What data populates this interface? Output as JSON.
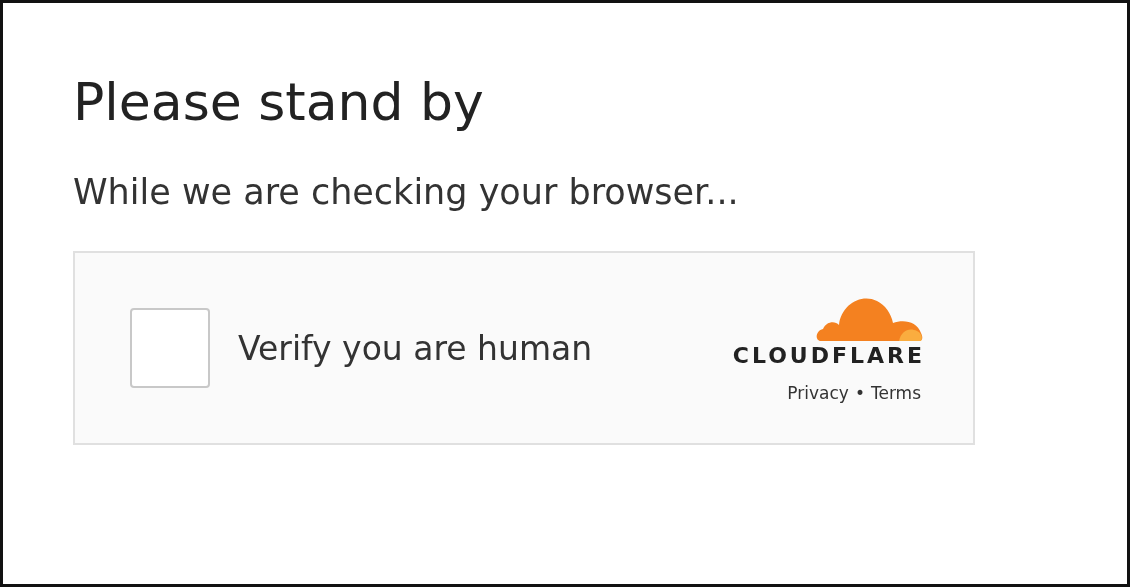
{
  "heading": "Please stand by",
  "subheading": "While we are checking your browser...",
  "challenge": {
    "checkbox": {
      "label": "Verify you are human",
      "checked": false
    },
    "brand": "CLOUDFLARE",
    "links": [
      "Privacy",
      "Terms"
    ],
    "separator": "•"
  }
}
